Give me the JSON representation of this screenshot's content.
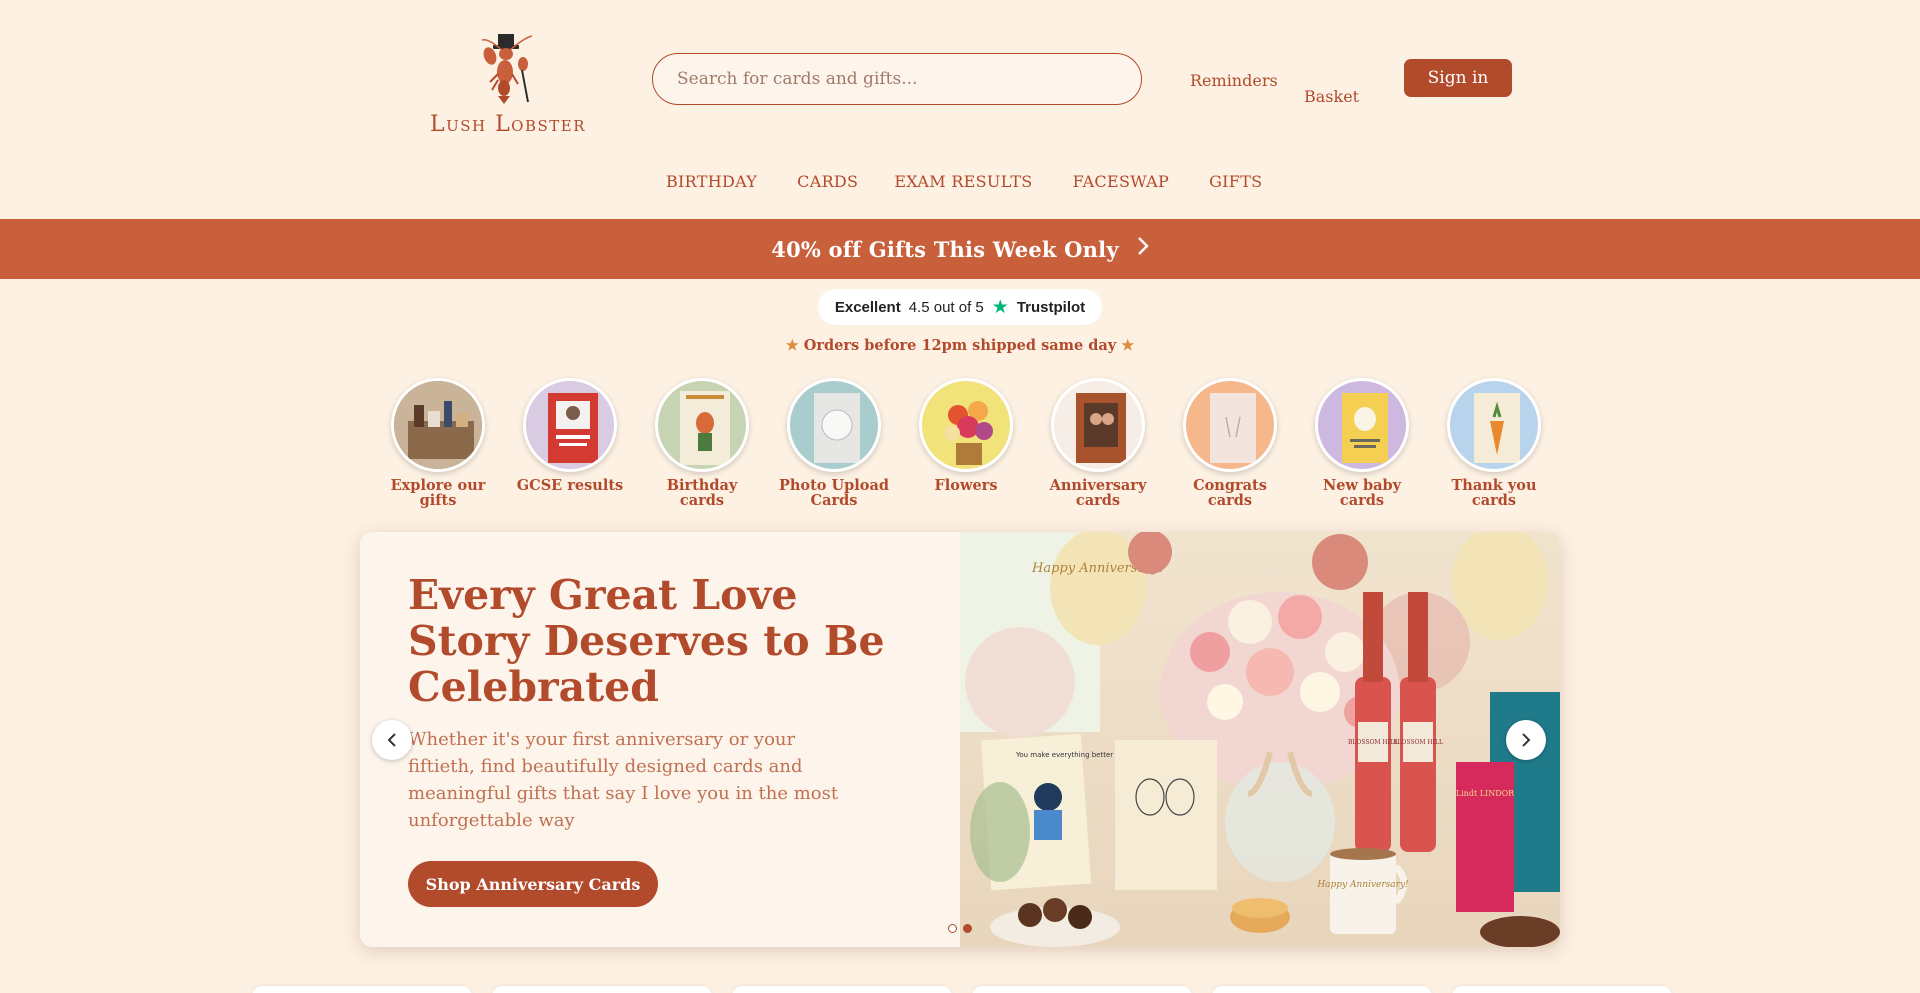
{
  "brand": {
    "name": "Lush Lobster"
  },
  "search": {
    "placeholder": "Search for cards and gifts..."
  },
  "header": {
    "reminders": "Reminders",
    "basket": "Basket",
    "signin": "Sign in"
  },
  "nav": {
    "items": [
      "BIRTHDAY",
      "CARDS",
      "EXAM RESULTS",
      "FACESWAP",
      "GIFTS"
    ]
  },
  "promo": {
    "text": "40% off Gifts This Week Only"
  },
  "trustpilot": {
    "rating_word": "Excellent",
    "score": "4.5 out of 5",
    "brand": "Trustpilot"
  },
  "shipping": {
    "text": "Orders before 12pm shipped same day"
  },
  "categories": [
    {
      "label": "Explore our gifts"
    },
    {
      "label": "GCSE results"
    },
    {
      "label": "Birthday cards"
    },
    {
      "label": "Photo Upload Cards"
    },
    {
      "label": "Flowers"
    },
    {
      "label": "Anniversary cards"
    },
    {
      "label": "Congrats cards"
    },
    {
      "label": "New baby cards"
    },
    {
      "label": "Thank you cards"
    }
  ],
  "hero": {
    "title": "Every Great Love Story Deserves to Be Celebrated",
    "subtitle": "Whether it's your first anniversary or your fiftieth, find beautifully designed cards and meaningful gifts that say I love you in the most unforgettable way",
    "cta": "Shop Anniversary Cards",
    "image_text": {
      "balloon": "Happy Anniversary!",
      "wine": "BLOSSOM HILL",
      "mug": "Happy Anniversary!",
      "card": "You make everything better",
      "chocolate": "Lindt LINDOR"
    }
  },
  "colors": {
    "accent": "#b24a2c",
    "promo": "#c9603c",
    "background": "#fdf1e3",
    "trust_star": "#00b67a"
  }
}
